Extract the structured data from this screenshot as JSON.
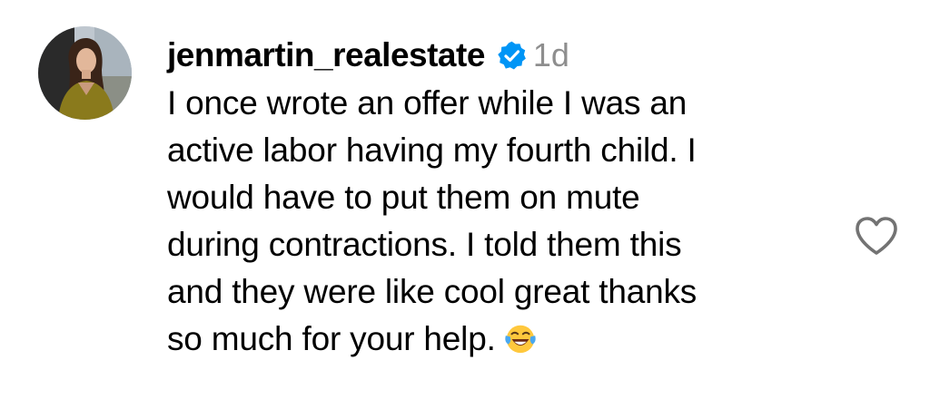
{
  "comment": {
    "username": "jenmartin_realestate",
    "verified": true,
    "timestamp": "1d",
    "lines": [
      "I once wrote an offer while I was an",
      "active labor having my fourth child. I",
      "would have to put them on mute",
      "during contractions. I told them this",
      "and they were like cool great thanks",
      "so much for your help."
    ],
    "emoji": "face-with-tears-of-joy",
    "like_icon": "heart-outline-icon",
    "colors": {
      "verified_badge": "#0095F6",
      "timestamp": "#8E8E8E",
      "text": "#000000",
      "heart_outline": "#737373"
    }
  }
}
